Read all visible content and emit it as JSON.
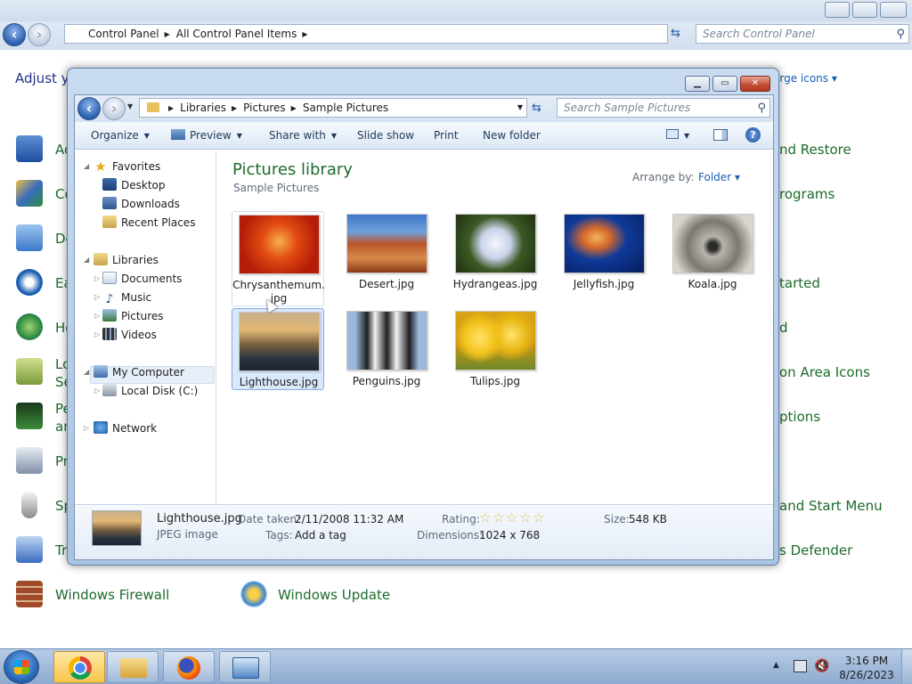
{
  "control_panel": {
    "breadcrumb": [
      "Control Panel",
      "All Control Panel Items"
    ],
    "search_placeholder": "Search Control Panel",
    "heading_partial": "Adjust y",
    "view_by_partial": "arge icons",
    "left_items": [
      {
        "label": "Ac",
        "icon": "action-center-flag-icon",
        "color": "#2d5ea8"
      },
      {
        "label": "Co",
        "icon": "color-management-icon",
        "color": "#3a6cbf"
      },
      {
        "label": "De",
        "icon": "desktop-gadgets-icon",
        "color": "#3b78c9"
      },
      {
        "label": "Ea",
        "icon": "ease-of-access-icon",
        "color": "#1e5fb2"
      },
      {
        "label": "Ho",
        "icon": "homegroup-icon",
        "color": "#2e8c3e"
      },
      {
        "label": "Lo",
        "label2": "Se",
        "icon": "location-sensors-icon",
        "color": "#7c9a3a"
      },
      {
        "label": "Pe",
        "label2": "an",
        "icon": "performance-icon",
        "color": "#3b8a3b"
      },
      {
        "label": "Pr",
        "icon": "programs-icon",
        "color": "#8090a8"
      },
      {
        "label": "Sp",
        "icon": "speech-microphone-icon",
        "color": "#7a7a7a"
      },
      {
        "label": "Tr",
        "icon": "troubleshooting-icon",
        "color": "#3a6cbf"
      },
      {
        "label": "Windows Firewall",
        "icon": "firewall-icon",
        "color": "#a04a2a"
      }
    ],
    "right_items": [
      "nd Restore",
      "rograms",
      "tarted",
      "d",
      "on Area Icons",
      "ptions",
      "and Start Menu",
      "s Defender"
    ],
    "bottom_item": {
      "label": "Windows Update",
      "icon": "windows-update-icon"
    }
  },
  "explorer": {
    "breadcrumb": [
      "Libraries",
      "Pictures",
      "Sample Pictures"
    ],
    "search_placeholder": "Search Sample Pictures",
    "toolbar": {
      "organize": "Organize",
      "preview": "Preview",
      "share_with": "Share with",
      "slideshow": "Slide show",
      "print": "Print",
      "new_folder": "New folder"
    },
    "nav": {
      "favorites": "Favorites",
      "desktop": "Desktop",
      "downloads": "Downloads",
      "recent": "Recent Places",
      "libraries": "Libraries",
      "documents": "Documents",
      "music": "Music",
      "pictures": "Pictures",
      "videos": "Videos",
      "computer": "My Computer",
      "local_disk": "Local Disk (C:)",
      "network": "Network"
    },
    "library_title": "Pictures library",
    "library_sub": "Sample Pictures",
    "arrange_label": "Arrange by:",
    "arrange_value": "Folder",
    "files": [
      {
        "name": "Chrysanthemum.",
        "name2": "jpg",
        "colors": [
          "#d8280c",
          "#f06a1a"
        ]
      },
      {
        "name": "Desert.jpg",
        "colors": [
          "#7a2e12",
          "#d97a3a"
        ]
      },
      {
        "name": "Hydrangeas.jpg",
        "colors": [
          "#2f4a1c",
          "#dfe4f2"
        ]
      },
      {
        "name": "Jellyfish.jpg",
        "colors": [
          "#0b2a7a",
          "#e3a04a"
        ]
      },
      {
        "name": "Koala.jpg",
        "colors": [
          "#6e6a62",
          "#d9d4cc"
        ]
      },
      {
        "name": "Lighthouse.jpg",
        "colors": [
          "#1f2c3a",
          "#d6a462"
        ]
      },
      {
        "name": "Penguins.jpg",
        "colors": [
          "#9ab8d9",
          "#1d1f22"
        ]
      },
      {
        "name": "Tulips.jpg",
        "colors": [
          "#f2c21a",
          "#6e8a2a"
        ]
      }
    ],
    "details": {
      "filename": "Lighthouse.jpg",
      "filetype": "JPEG image",
      "date_label": "Date taken:",
      "date_value": "2/11/2008 11:32 AM",
      "tags_label": "Tags:",
      "tags_value": "Add a tag",
      "rating_label": "Rating:",
      "rating_stars": 0,
      "dimensions_label": "Dimensions:",
      "dimensions_value": "1024 x 768",
      "size_label": "Size:",
      "size_value": "548 KB"
    }
  },
  "taskbar": {
    "apps": [
      "chrome-icon",
      "file-explorer-icon",
      "firefox-icon",
      "control-panel-icon"
    ],
    "time": "3:16 PM",
    "date": "8/26/2023"
  }
}
